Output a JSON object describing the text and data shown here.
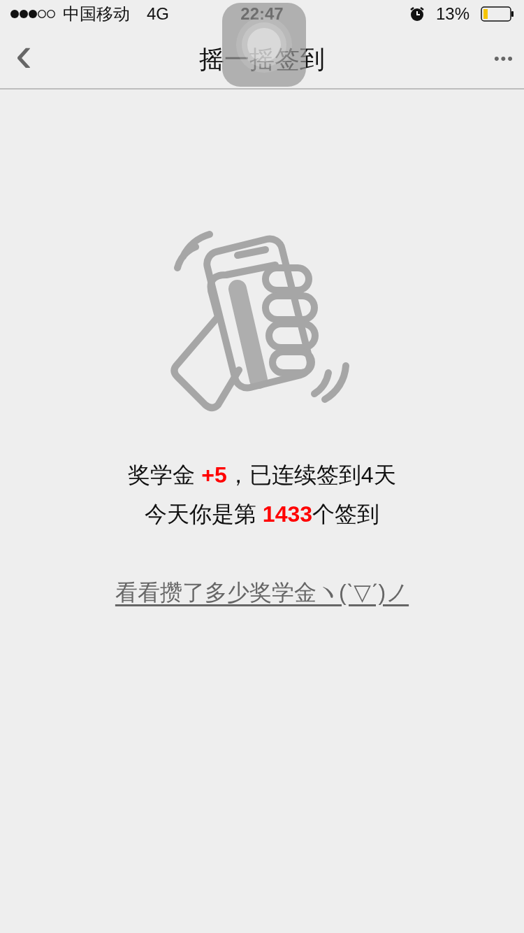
{
  "status_bar": {
    "carrier": "中国移动",
    "network": "4G",
    "time": "22:47",
    "battery_percent": "13%"
  },
  "nav_bar": {
    "back": "‹",
    "title": "摇一摇签到",
    "more": "•••"
  },
  "result": {
    "lines": [
      "奖学金 **+5**，已连续签到4天",
      "今天你是第 **1433**个签到"
    ]
  },
  "link": "看看攒了多少奖学金ヽ(ˋ▽ˊ)ノ"
}
